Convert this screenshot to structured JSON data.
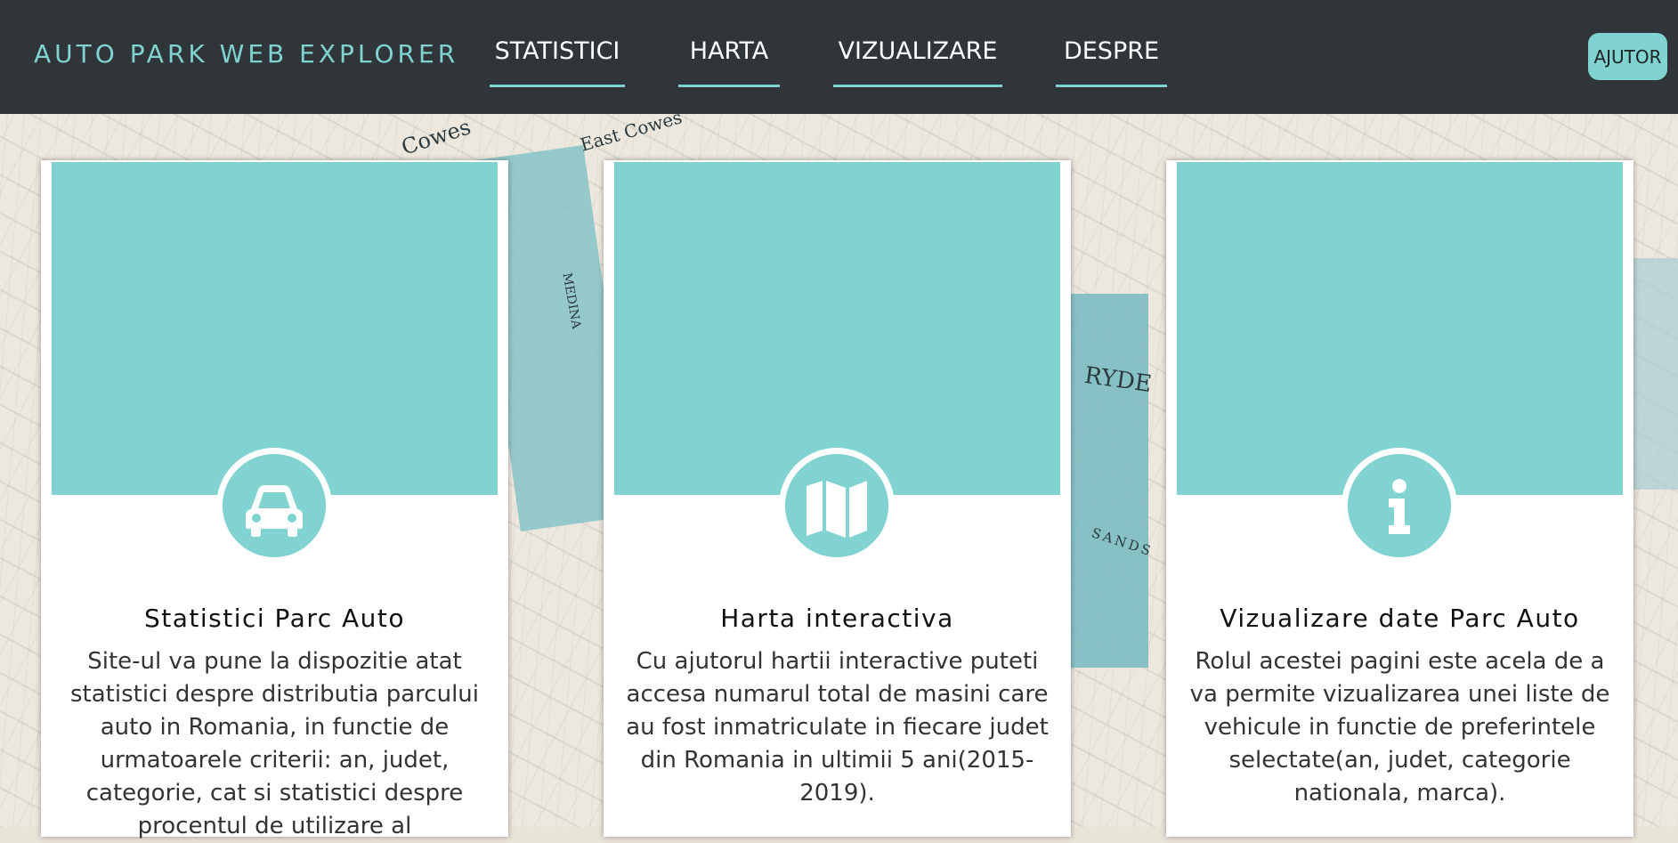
{
  "header": {
    "brand": "AUTO PARK WEB EXPLORER",
    "nav": [
      {
        "label": "STATISTICI"
      },
      {
        "label": "HARTA"
      },
      {
        "label": "VIZUALIZARE"
      },
      {
        "label": "DESPRE"
      }
    ],
    "help_label": "AJUTOR"
  },
  "background_labels": [
    "Cowes",
    "MEDINA",
    "RYDE",
    "SANDS",
    "East Cowes"
  ],
  "cards": [
    {
      "icon": "car-icon",
      "title": "Statistici Parc Auto",
      "text": "Site-ul va pune la dispozitie atat statistici despre distributia parcului auto in Romania, in functie de urmatoarele criterii: an, judet, categorie, cat si statistici despre procentul de utilizare al"
    },
    {
      "icon": "map-icon",
      "title": "Harta interactiva",
      "text": "Cu ajutorul hartii interactive puteti accesa numarul total de masini care au fost inmatriculate in fiecare judet din Romania in ultimii 5 ani(2015-2019)."
    },
    {
      "icon": "info-icon",
      "title": "Vizualizare date Parc Auto",
      "text": "Rolul acestei pagini este acela de a va permite vizualizarea unei liste de vehicule in functie de preferintele selectate(an, judet, categorie nationala, marca)."
    }
  ],
  "colors": {
    "accent": "#80d3d0",
    "navbar": "#2f3538",
    "card": "#ffffff"
  }
}
